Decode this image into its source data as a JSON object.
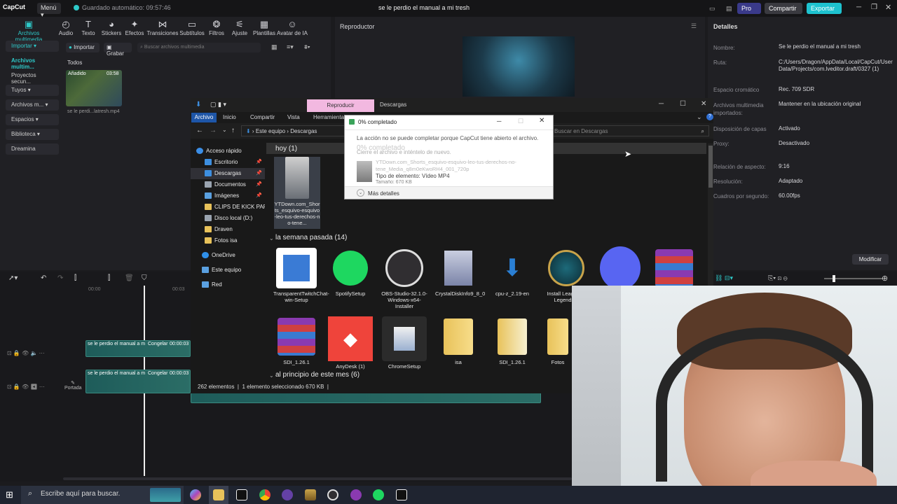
{
  "capcut": {
    "logo": "CapCut",
    "menu": "Menú",
    "autosave": "Guardado automático: 09:57:46",
    "title": "se le perdio el manual a mi tresh",
    "pro": "Pro",
    "share": "Compartir",
    "export": "Exportar",
    "tools": [
      "Archivos multimedia",
      "Audio",
      "Texto",
      "Stickers",
      "Efectos",
      "Transiciones",
      "Subtítulos",
      "Filtros",
      "Ajuste",
      "Plantillas",
      "Avatar de IA"
    ],
    "sidebar": [
      "Importar",
      "Archivos multim...",
      "Proyectos secun...",
      "Tuyos",
      "Archivos m...",
      "Espacios",
      "Biblioteca",
      "Dreamina"
    ],
    "import_btn": "Importar",
    "record_btn": "Grabar",
    "search_placeholder": "Buscar archivos multimedia",
    "all_label": "Todos",
    "thumb_badge": "Añadido",
    "thumb_duration": "03:58",
    "thumb_name": "se le perdi...latresh.mp4",
    "player_title": "Reproductor",
    "details_title": "Detalles",
    "details": [
      {
        "label": "Nombre:",
        "value": "Se le perdio el manual a mi tresh"
      },
      {
        "label": "Ruta:",
        "value": "C:/Users/Dragon/AppData/Local/CapCut/User Data/Projects/com.lveditor.draft/0327 (1)"
      },
      {
        "label": "Espacio cromático",
        "value": "Rec. 709 SDR"
      },
      {
        "label": "Archivos multimedia importados:",
        "value": "Mantener en la ubicación original"
      },
      {
        "label": "Disposición de capas",
        "value": "Activado"
      },
      {
        "label": "Proxy:",
        "value": "Desactivado"
      },
      {
        "label": "Relación de aspecto:",
        "value": "9:16"
      },
      {
        "label": "Resolución:",
        "value": "Adaptado"
      },
      {
        "label": "Cuadros por segundo:",
        "value": "60.00fps"
      }
    ],
    "modify_btn": "Modificar",
    "time_ticks": [
      "00:00",
      "00:03"
    ],
    "clip1_label": "se le perdio el manual a m",
    "clip1_freeze": "Congelar",
    "clip1_time": "00:00:03",
    "cover_label": "Portada"
  },
  "explorer": {
    "tab_play": "Reproducir",
    "tab_downloads": "Descargas",
    "ribbon": [
      "Archivo",
      "Inicio",
      "Compartir",
      "Vista",
      "Herramienta"
    ],
    "breadcrumb": [
      "Este equipo",
      "Descargas"
    ],
    "search_placeholder": "Buscar en Descargas",
    "nav": [
      {
        "label": "Acceso rápido",
        "color": "#3b8ee6"
      },
      {
        "label": "Escritorio",
        "color": "#3d8fe0"
      },
      {
        "label": "Descargas",
        "color": "#3d8fe0"
      },
      {
        "label": "Documentos",
        "color": "#9aa4b0"
      },
      {
        "label": "Imágenes",
        "color": "#5aa0e0"
      },
      {
        "label": "CLIPS DE KICK PARA",
        "color": "#e8c25a"
      },
      {
        "label": "Disco local (D:)",
        "color": "#9aa4b0"
      },
      {
        "label": "Draven",
        "color": "#e8c25a"
      },
      {
        "label": "Fotos isa",
        "color": "#e8c25a"
      },
      {
        "label": "OneDrive",
        "color": "#2f8fe8"
      },
      {
        "label": "Este equipo",
        "color": "#5aa0e0"
      },
      {
        "label": "Red",
        "color": "#5aa0e0"
      }
    ],
    "group_today": "hoy (1)",
    "today_file": "YTDown.com_Shorts_esquivo-esquivo-leo-tus-derechos-no-tene...",
    "group_week": "la semana pasada (14)",
    "week_files": [
      {
        "name": "TransparentTwitchChat-win-Setup",
        "icon": "win-installer-icon",
        "color": "#3a7bd5"
      },
      {
        "name": "SpotifySetup",
        "icon": "spotify-icon",
        "color": "#1ed760"
      },
      {
        "name": "OBS-Studio-32.1.0-Windows-x64-Installer",
        "icon": "obs-icon",
        "color": "#302e31"
      },
      {
        "name": "CrystalDiskInfo9_8_0",
        "icon": "installer-icon",
        "color": "#8a8fa8"
      },
      {
        "name": "cpu-z_2.19-en",
        "icon": "download-icon",
        "color": "#2a7fd4"
      },
      {
        "name": "Install League of Legends e",
        "icon": "league-icon",
        "color": "#c8a34a"
      },
      {
        "name": "",
        "icon": "discord-icon",
        "color": "#5865f2"
      },
      {
        "name": "",
        "icon": "winrar-icon",
        "color": "#8a3ab0"
      }
    ],
    "row2_files": [
      {
        "name": "SDI_1.26.1",
        "icon": "winrar-icon",
        "color": "#8a3ab0"
      },
      {
        "name": "AnyDesk (1)",
        "icon": "anydesk-icon",
        "color": "#ef443b"
      },
      {
        "name": "ChromeSetup",
        "icon": "chrome-setup-icon",
        "color": "#2b2b2b"
      },
      {
        "name": "isa",
        "icon": "folder-icon",
        "color": "#e8c25a"
      },
      {
        "name": "SDI_1.26.1",
        "icon": "folder-icon",
        "color": "#e8c25a"
      },
      {
        "name": "Fotos",
        "icon": "folder-icon",
        "color": "#e8c25a"
      }
    ],
    "group_month": "al principio de este mes (6)",
    "status_count": "262 elementos",
    "status_selected": "1 elemento seleccionado  670 KB"
  },
  "dialog": {
    "title": "0% completado",
    "line1": "La acción no se puede completar porque CapCut tiene abierto el archivo.",
    "line1b": "Cierre el archivo e inténtelo de nuevo.",
    "ghost": "0% completado",
    "filename": "YTDown.com_Shorts_esquivo-esquivo-leo-tus-derechos-no-tene_Media_q8m0eKwoRH4_001_720p",
    "type": "Tipo de elemento: Vídeo MP4",
    "size": "Tamaño: 670 KB",
    "more": "Más detalles"
  },
  "taskbar": {
    "search": "Escribe aquí para buscar."
  }
}
